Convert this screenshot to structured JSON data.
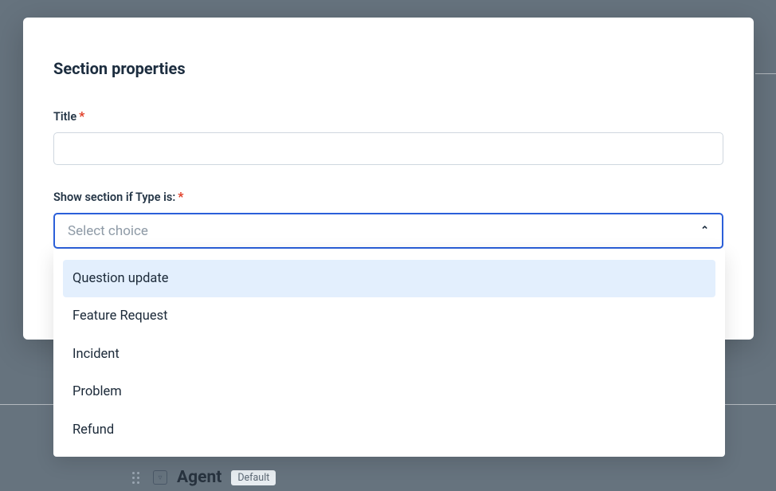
{
  "modal": {
    "title": "Section properties",
    "fields": {
      "title": {
        "label": "Title",
        "required_marker": "*",
        "value": ""
      },
      "condition": {
        "label": "Show section if Type is:",
        "required_marker": "*",
        "placeholder": "Select choice"
      }
    }
  },
  "dropdown": {
    "options": [
      "Question update",
      "Feature Request",
      "Incident",
      "Problem",
      "Refund"
    ]
  },
  "background_row": {
    "name": "Agent",
    "chip": "Default",
    "icon_glyph": "▿"
  }
}
